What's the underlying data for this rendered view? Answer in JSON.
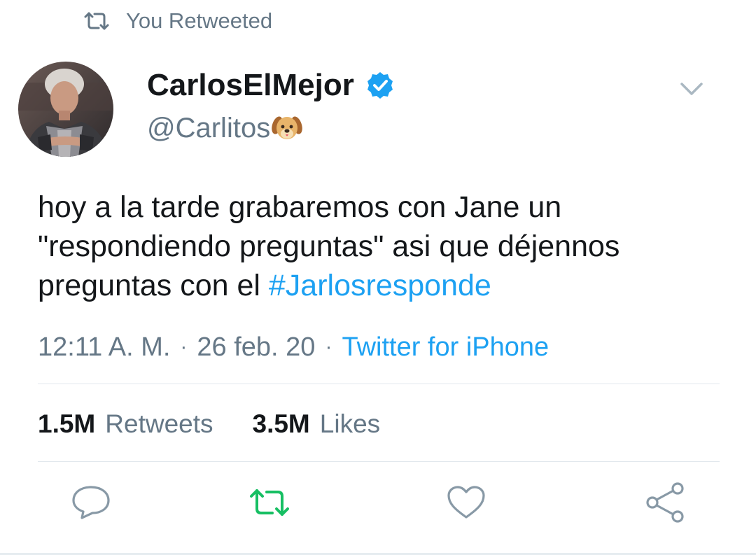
{
  "context": {
    "label": "You Retweeted",
    "icon": "retweet-icon"
  },
  "author": {
    "display_name": "CarlosElMejor",
    "handle": "@Carlitos",
    "handle_emoji": "dog-face-emoji",
    "verified": true
  },
  "tweet": {
    "text": "hoy a la tarde grabaremos con Jane un \"respondiendo preguntas\" asi que déjennos preguntas con el ",
    "hashtag": "#Jarlosresponde"
  },
  "meta": {
    "time": "12:11 A. M.",
    "separator": "·",
    "date": "26 feb. 20",
    "source": "Twitter for iPhone"
  },
  "stats": {
    "retweets_count": "1.5M",
    "retweets_label": "Retweets",
    "likes_count": "3.5M",
    "likes_label": "Likes"
  },
  "actions": {
    "reply_icon": "reply-icon",
    "retweet_icon": "retweet-icon",
    "like_icon": "heart-icon",
    "share_icon": "share-icon",
    "retweeted": true
  },
  "colors": {
    "accent": "#1da1f2",
    "retweet_active": "#17bf63",
    "secondary_text": "#657786",
    "primary_text": "#14171a"
  }
}
